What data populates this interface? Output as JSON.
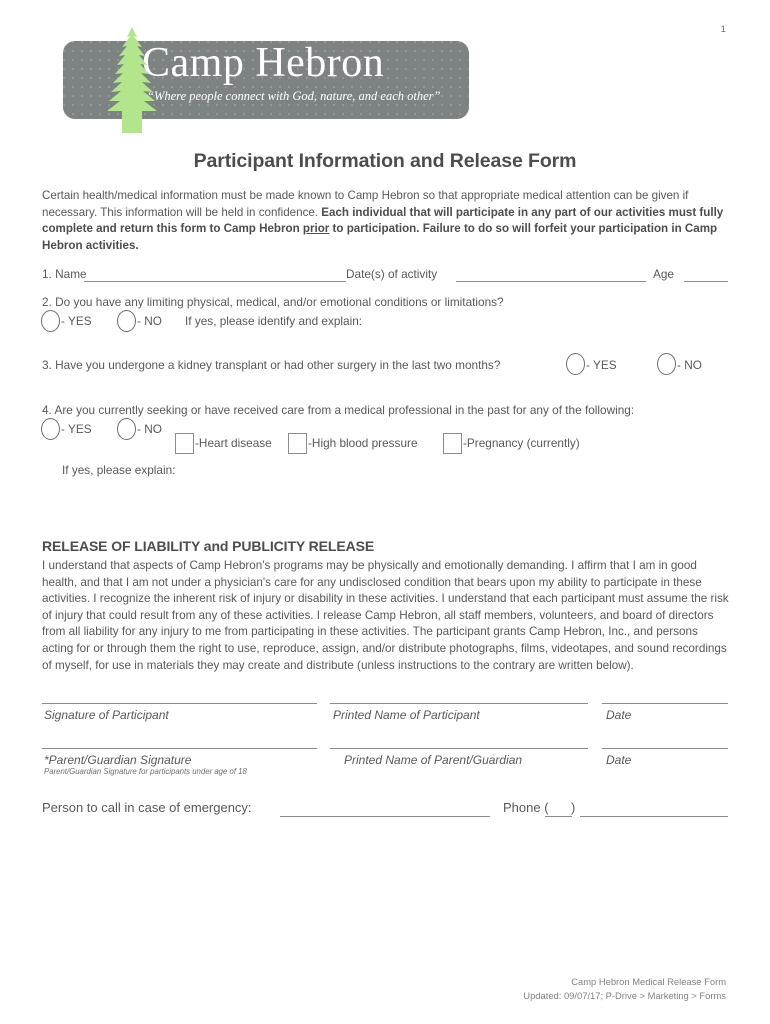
{
  "page": {
    "number": "1",
    "background_color": "#ffffff",
    "text_color": "#58595b"
  },
  "logo": {
    "plate_color": "#7d8382",
    "tree_color": "#b3e68c",
    "title": "Camp Hebron",
    "tagline": "“Where people connect with God, nature, and each other”",
    "tree_icon": "pine-tree-icon"
  },
  "document": {
    "title": "Participant Information and Release Form",
    "intro": {
      "plain_1": "Certain health/medical information must be made known to Camp Hebron so that appropriate medical attention can be given if necessary. This information will be held in confidence. ",
      "bold_1": "Each individual that will participate in any part of our activities must fully complete and return this form to Camp Hebron ",
      "bold_underline": "prior",
      "bold_2": " to participation. Failure to do so will forfeit your participation in Camp Hebron activities."
    }
  },
  "questions": [
    {
      "id": "q1",
      "label": "1. Name",
      "fields": [
        {
          "label": "Date(s) of activity"
        },
        {
          "label": "Age"
        }
      ]
    },
    {
      "id": "q2",
      "text": "2. Do you have any limiting physical, medical, and/or emotional conditions or limitations?",
      "options": [
        "- YES",
        "- NO"
      ],
      "followup": "If yes, please identify and explain:"
    },
    {
      "id": "q3",
      "text": "3. Have you undergone a kidney transplant or had other surgery in the last two months?",
      "options": [
        "- YES",
        "- NO"
      ]
    },
    {
      "id": "q4",
      "text": "4. Are you currently seeking or have received care from a medical professional in the past for any of the following:",
      "options": [
        "- YES",
        "- NO"
      ],
      "checkboxes": [
        "-Heart disease",
        "-High blood pressure",
        "-Pregnancy (currently)"
      ],
      "followup": "If yes, please explain:"
    }
  ],
  "release": {
    "heading": "RELEASE OF LIABILITY and PUBLICITY RELEASE",
    "body": "I understand that aspects of Camp Hebron's programs may be physically and emotionally demanding. I affirm that I am in good health, and that I am not under a physician's care for any undisclosed condition that bears upon my ability to participate in these activities. I recognize the inherent risk of injury or disability in these activities. I understand that each participant must assume the risk of injury that could result from any of these activities. I release Camp Hebron, all staff members, volunteers, and board of directors from all liability for any injury to me from participating in these activities. The participant grants Camp Hebron, Inc., and persons acting for or through them the right to use, reproduce, assign, and/or distribute photographs, films, videotapes, and sound recordings of myself, for use in materials they may create and distribute (unless instructions to the contrary are written below)."
  },
  "signatures": {
    "row1": {
      "signature_label": "Signature of Participant",
      "printed_label": "Printed Name of Participant",
      "date_label": "Date"
    },
    "row2": {
      "signature_label": "*Parent/Guardian Signature",
      "signature_note": "Parent/Guardian Signature for participants under age of 18",
      "printed_label": "Printed Name of Parent/Guardian",
      "date_label": "Date"
    }
  },
  "emergency": {
    "label": "Person to call in case of emergency:",
    "phone_label": "Phone (",
    "phone_label_close": ")"
  },
  "footer": {
    "line1": "Camp Hebron Medical Release Form",
    "line2": "Updated: 09/07/17; P-Drive > Marketing > Forms"
  }
}
